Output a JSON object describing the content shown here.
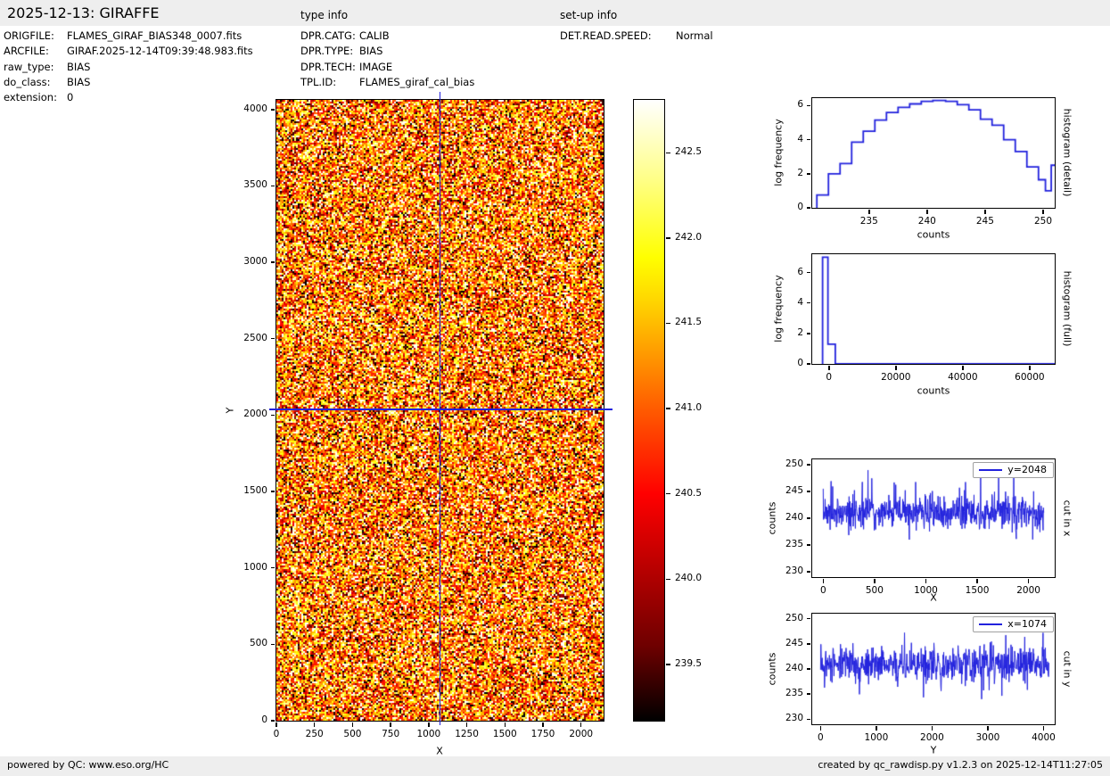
{
  "header": {
    "title": "2025-12-13: GIRAFFE",
    "type_info_label": "type info",
    "setup_info_label": "set-up info"
  },
  "metadata": {
    "file_info": [
      {
        "label": "ORIGFILE:",
        "value": "FLAMES_GIRAF_BIAS348_0007.fits"
      },
      {
        "label": "ARCFILE:",
        "value": "GIRAF.2025-12-14T09:39:48.983.fits"
      },
      {
        "label": "raw_type:",
        "value": "BIAS"
      },
      {
        "label": "do_class:",
        "value": "BIAS"
      },
      {
        "label": "extension:",
        "value": "0"
      }
    ],
    "type_info": [
      {
        "label": "DPR.CATG:",
        "value": "CALIB"
      },
      {
        "label": "DPR.TYPE:",
        "value": "BIAS"
      },
      {
        "label": "DPR.TECH:",
        "value": "IMAGE"
      },
      {
        "label": "TPL.ID:",
        "value": "FLAMES_giraf_cal_bias"
      }
    ],
    "setup_info": [
      {
        "label": "DET.READ.SPEED:",
        "value": "Normal"
      }
    ]
  },
  "footer": {
    "left": "powered by QC: www.eso.org/HC",
    "right": "created by qc_rawdisp.py v1.2.3 on 2025-12-14T11:27:05"
  },
  "colors": {
    "plot_blue": "#2222dd",
    "strip_bg": "#eeeeee",
    "axis_black": "#000000"
  },
  "chart_data": [
    {
      "type": "heatmap",
      "xlabel": "X",
      "ylabel": "Y",
      "xlim": [
        0,
        2148
      ],
      "ylim": [
        0,
        4063
      ],
      "xticks": [
        0,
        250,
        500,
        750,
        1000,
        1250,
        1500,
        1750,
        2000
      ],
      "yticks": [
        0,
        500,
        1000,
        1500,
        2000,
        2500,
        3000,
        3500,
        4000
      ],
      "colormap": "hot",
      "vmin": 239.2,
      "vmax": 242.8,
      "crosshair": {
        "x": 1074,
        "y": 2048
      },
      "noise": {
        "mean_norm": 0.56,
        "sigma_norm": 0.3,
        "seed": 42
      }
    },
    {
      "type": "colorbar",
      "colormap": "hot",
      "vmin": 239.17,
      "vmax": 242.81,
      "ticks": [
        242.5,
        242.0,
        241.5,
        241.0,
        240.5,
        240.0,
        239.5
      ],
      "tick_format": "fixed1"
    },
    {
      "type": "histogram-step",
      "right_label": "histogram (detail)",
      "xlabel": "counts",
      "ylabel": "log frequency",
      "xlim": [
        230.1,
        251.0
      ],
      "ylim": [
        0,
        6.44
      ],
      "xticks": [
        235,
        240,
        245,
        250
      ],
      "yticks": [
        0,
        2,
        4,
        6
      ],
      "steps": [
        [
          230.5,
          0.75
        ],
        [
          231.5,
          2.0
        ],
        [
          232.5,
          2.6
        ],
        [
          233.5,
          3.85
        ],
        [
          234.5,
          4.5
        ],
        [
          235.5,
          5.15
        ],
        [
          236.5,
          5.6
        ],
        [
          237.5,
          5.9
        ],
        [
          238.5,
          6.1
        ],
        [
          239.5,
          6.25
        ],
        [
          240.5,
          6.3
        ],
        [
          241.6,
          6.25
        ],
        [
          242.6,
          6.05
        ],
        [
          243.6,
          5.75
        ],
        [
          244.6,
          5.2
        ],
        [
          245.6,
          4.85
        ],
        [
          246.6,
          4.0
        ],
        [
          247.6,
          3.3
        ],
        [
          248.6,
          2.4
        ],
        [
          249.6,
          1.65
        ],
        [
          250.2,
          1.0
        ],
        [
          250.7,
          2.5
        ]
      ]
    },
    {
      "type": "histogram-step",
      "right_label": "histogram (full)",
      "xlabel": "counts",
      "ylabel": "log frequency",
      "xlim": [
        -5000,
        67500
      ],
      "ylim": [
        0,
        7.2
      ],
      "xticks": [
        0,
        20000,
        40000,
        60000
      ],
      "yticks": [
        0,
        2,
        4,
        6
      ],
      "steps": [
        [
          -1900,
          7.0
        ],
        [
          -300,
          1.3
        ],
        [
          1900,
          0
        ]
      ]
    },
    {
      "type": "line",
      "legend": "y=2048",
      "right_label": "cut in x",
      "xlabel": "X",
      "ylabel": "counts",
      "xlim": [
        -107,
        2255
      ],
      "ylim": [
        229,
        251
      ],
      "xticks": [
        0,
        500,
        1000,
        1500,
        2000
      ],
      "yticks": [
        230,
        235,
        240,
        245,
        250
      ],
      "series": {
        "x_range": [
          0,
          2148
        ],
        "mean": 241.1,
        "sigma": 1.6,
        "min": 236.0,
        "max": 249.2,
        "n": 700,
        "seed": 7
      }
    },
    {
      "type": "line",
      "legend": "x=1074",
      "right_label": "cut in y",
      "xlabel": "Y",
      "ylabel": "counts",
      "xlim": [
        -150,
        4200
      ],
      "ylim": [
        229,
        251
      ],
      "xticks": [
        0,
        1000,
        2000,
        3000,
        4000
      ],
      "yticks": [
        230,
        235,
        240,
        245,
        250
      ],
      "series": {
        "x_range": [
          0,
          4096
        ],
        "mean": 241.0,
        "sigma": 1.7,
        "min": 234.0,
        "max": 247.2,
        "n": 700,
        "seed": 13
      }
    }
  ]
}
